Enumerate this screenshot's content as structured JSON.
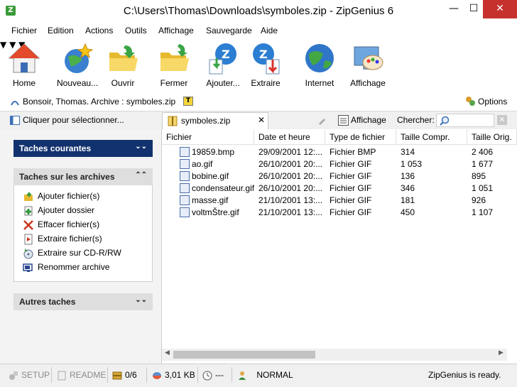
{
  "window": {
    "title": "C:\\Users\\Thomas\\Downloads\\symboles.zip - ZipGenius 6",
    "minimize": "—",
    "maximize": "☐",
    "close": "✕"
  },
  "menu": [
    "Fichier",
    "Edition",
    "Actions",
    "Outils",
    "Affichage",
    "Sauvegarde",
    "Aide"
  ],
  "toolbar": {
    "home": "Home",
    "nouveau": "Nouveau...",
    "ouvrir": "Ouvrir",
    "fermer": "Fermer",
    "ajouter": "Ajouter...",
    "extraire": "Extraire",
    "internet": "Internet",
    "affichage": "Affichage"
  },
  "info": {
    "greeting": "Bonsoir, Thomas. Archive : symboles.zip",
    "badge": "T",
    "options": "Options"
  },
  "tabs": {
    "select_label": "Cliquer pour sélectionner...",
    "active_tab": "symboles.zip",
    "afficher": "Affichage",
    "chercher": "Chercher:",
    "search_value": ""
  },
  "tasks": {
    "current": "Taches courantes",
    "archives": "Taches sur les archives",
    "others": "Autres taches",
    "items": [
      "Ajouter fichier(s)",
      "Ajouter dossier",
      "Effacer fichier(s)",
      "Extraire fichier(s)",
      "Extraire sur CD-R/RW",
      "Renommer archive"
    ]
  },
  "files": {
    "columns": [
      "Fichier",
      "Date et heure",
      "Type de fichier",
      "Taille Compr.",
      "Taille Orig."
    ],
    "rows": [
      {
        "name": "19859.bmp",
        "date": "29/09/2001 12:...",
        "type": "Fichier BMP",
        "comp": "314",
        "orig": "2 406"
      },
      {
        "name": "ao.gif",
        "date": "26/10/2001 20:...",
        "type": "Fichier GIF",
        "comp": "1 053",
        "orig": "1 677"
      },
      {
        "name": "bobine.gif",
        "date": "26/10/2001 20:...",
        "type": "Fichier GIF",
        "comp": "136",
        "orig": "895"
      },
      {
        "name": "condensateur.gif",
        "date": "26/10/2001 20:...",
        "type": "Fichier GIF",
        "comp": "346",
        "orig": "1 051"
      },
      {
        "name": "masse.gif",
        "date": "21/10/2001 13:...",
        "type": "Fichier GIF",
        "comp": "181",
        "orig": "926"
      },
      {
        "name": "voltmŠtre.gif",
        "date": "21/10/2001 13:...",
        "type": "Fichier GIF",
        "comp": "450",
        "orig": "1 107"
      }
    ]
  },
  "status": {
    "setup": "SETUP",
    "readme": "README",
    "count": "0/6",
    "size": "3,01 KB",
    "time": "---",
    "mode": "NORMAL",
    "ready": "ZipGenius is ready."
  }
}
